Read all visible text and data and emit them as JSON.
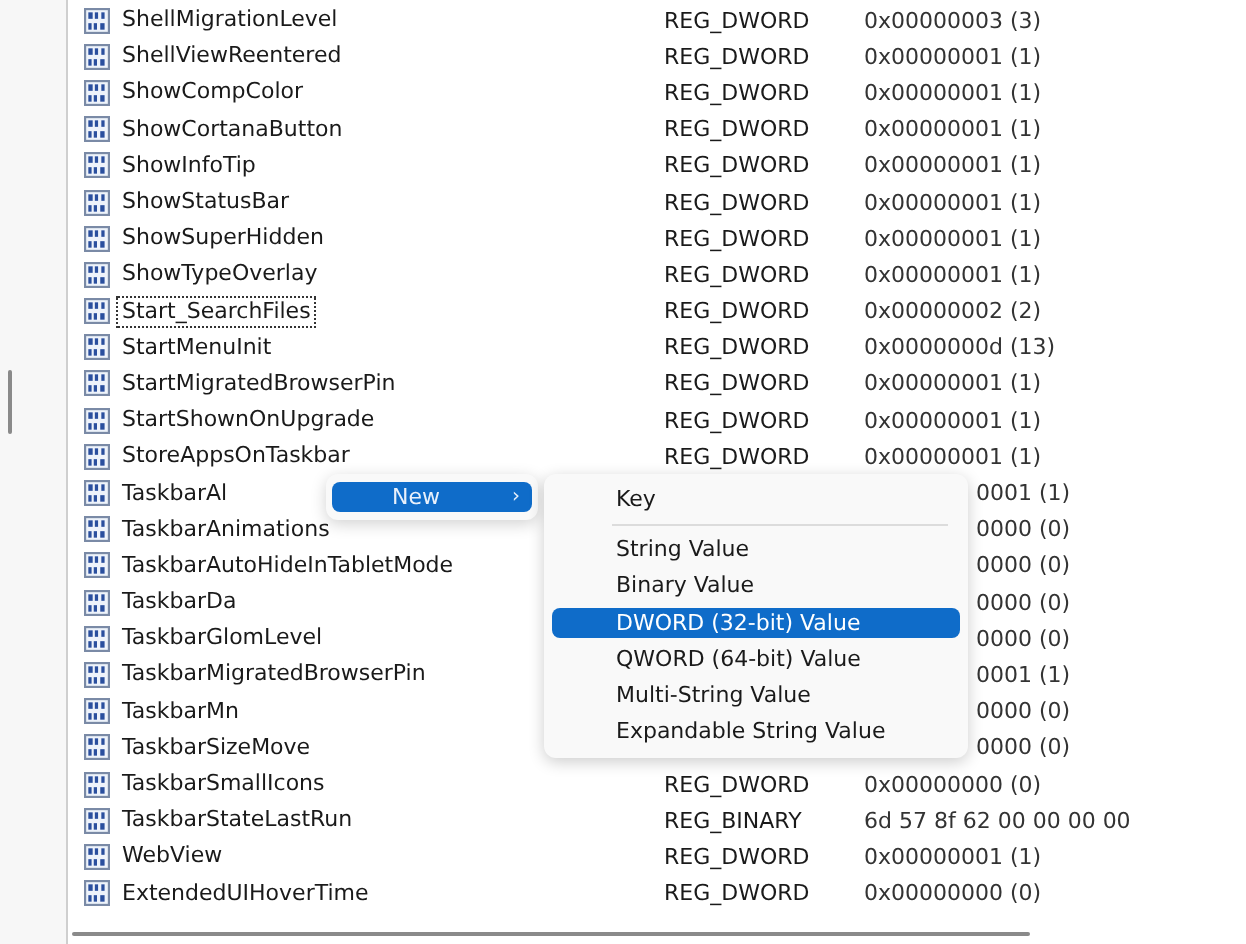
{
  "values_list": {
    "rows": [
      {
        "name": "ShellMigrationLevel",
        "type": "REG_DWORD",
        "data": "0x00000003 (3)",
        "focused": false
      },
      {
        "name": "ShellViewReentered",
        "type": "REG_DWORD",
        "data": "0x00000001 (1)",
        "focused": false
      },
      {
        "name": "ShowCompColor",
        "type": "REG_DWORD",
        "data": "0x00000001 (1)",
        "focused": false
      },
      {
        "name": "ShowCortanaButton",
        "type": "REG_DWORD",
        "data": "0x00000001 (1)",
        "focused": false
      },
      {
        "name": "ShowInfoTip",
        "type": "REG_DWORD",
        "data": "0x00000001 (1)",
        "focused": false
      },
      {
        "name": "ShowStatusBar",
        "type": "REG_DWORD",
        "data": "0x00000001 (1)",
        "focused": false
      },
      {
        "name": "ShowSuperHidden",
        "type": "REG_DWORD",
        "data": "0x00000001 (1)",
        "focused": false
      },
      {
        "name": "ShowTypeOverlay",
        "type": "REG_DWORD",
        "data": "0x00000001 (1)",
        "focused": false
      },
      {
        "name": "Start_SearchFiles",
        "type": "REG_DWORD",
        "data": "0x00000002 (2)",
        "focused": true
      },
      {
        "name": "StartMenuInit",
        "type": "REG_DWORD",
        "data": "0x0000000d (13)",
        "focused": false
      },
      {
        "name": "StartMigratedBrowserPin",
        "type": "REG_DWORD",
        "data": "0x00000001 (1)",
        "focused": false
      },
      {
        "name": "StartShownOnUpgrade",
        "type": "REG_DWORD",
        "data": "0x00000001 (1)",
        "focused": false
      },
      {
        "name": "StoreAppsOnTaskbar",
        "type": "REG_DWORD",
        "data": "0x00000001 (1)",
        "focused": false
      },
      {
        "name": "TaskbarAl",
        "data": "0001 (1)",
        "focused": false
      },
      {
        "name": "TaskbarAnimations",
        "data": "0000 (0)",
        "focused": false
      },
      {
        "name": "TaskbarAutoHideInTabletMode",
        "data": "0000 (0)",
        "focused": false
      },
      {
        "name": "TaskbarDa",
        "data": "0000 (0)",
        "focused": false
      },
      {
        "name": "TaskbarGlomLevel",
        "data": "0000 (0)",
        "focused": false
      },
      {
        "name": "TaskbarMigratedBrowserPin",
        "data": "0001 (1)",
        "focused": false
      },
      {
        "name": "TaskbarMn",
        "data": "0000 (0)",
        "focused": false
      },
      {
        "name": "TaskbarSizeMove",
        "data": "0000 (0)",
        "focused": false
      },
      {
        "name": "TaskbarSmallIcons",
        "type": "REG_DWORD",
        "data": "0x00000000 (0)",
        "focused": false
      },
      {
        "name": "TaskbarStateLastRun",
        "type": "REG_BINARY",
        "data": "6d 57 8f 62 00 00 00 00",
        "focused": false
      },
      {
        "name": "WebView",
        "type": "REG_DWORD",
        "data": "0x00000001 (1)",
        "focused": false
      },
      {
        "name": "ExtendedUIHoverTime",
        "type": "REG_DWORD",
        "data": "0x00000000 (0)",
        "focused": false
      }
    ]
  },
  "context_menu": {
    "items": [
      {
        "label": "New",
        "arrow": "›",
        "selected": true
      }
    ]
  },
  "submenu": {
    "items": [
      {
        "kind": "item",
        "label": "Key",
        "selected": false
      },
      {
        "kind": "separator"
      },
      {
        "kind": "item",
        "label": "String Value",
        "selected": false
      },
      {
        "kind": "item",
        "label": "Binary Value",
        "selected": false
      },
      {
        "kind": "item",
        "label": "DWORD (32-bit) Value",
        "selected": true
      },
      {
        "kind": "item",
        "label": "QWORD (64-bit) Value",
        "selected": false
      },
      {
        "kind": "item",
        "label": "Multi-String Value",
        "selected": false
      },
      {
        "kind": "item",
        "label": "Expandable String Value",
        "selected": false
      }
    ]
  }
}
